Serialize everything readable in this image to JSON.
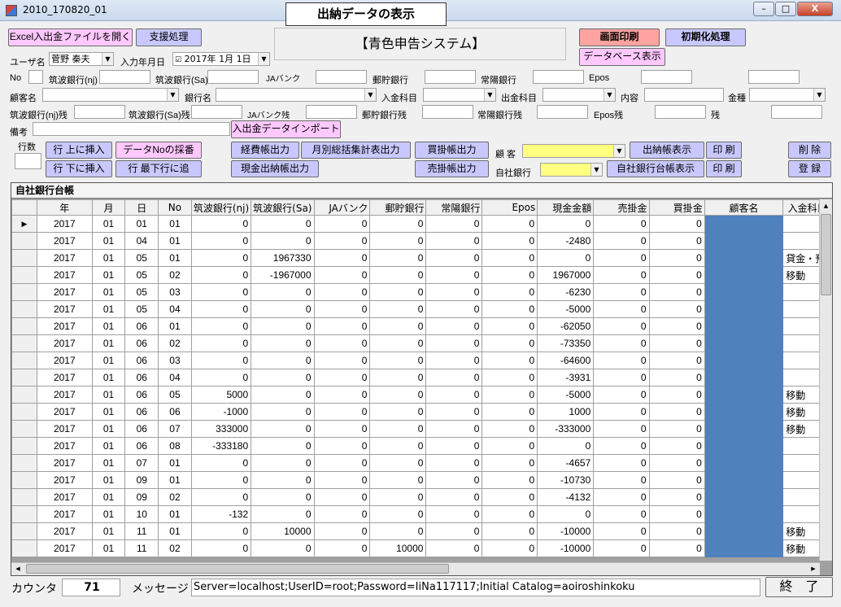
{
  "window": {
    "title": "2010_170820_01",
    "min": "–",
    "max": "□",
    "close": "X"
  },
  "header": {
    "form_title": "出納データの表示",
    "system_title": "【青色申告システム】"
  },
  "buttons": {
    "excel_open": "Excel入出金ファイルを開く",
    "support": "支援処理",
    "print_screen": "画面印刷",
    "init": "初期化処理",
    "db_view": "データベース表示",
    "import": "入出金データインポート",
    "insert_above": "行 上に挿入",
    "insert_below": "行 下に挿入",
    "renumber": "データNoの採番",
    "add_last": "行 最下行に追",
    "expense": "経費帳出力",
    "monthly": "月別総括集計表出力",
    "cash_book": "現金出納帳出力",
    "payable": "買掛帳出力",
    "receivable": "売掛帳出力",
    "cashbook_show": "出納帳表示",
    "print1": "印 刷",
    "print2": "印 刷",
    "bank_ledger": "自社銀行台帳表示",
    "delete": "削 除",
    "register": "登 録",
    "exit": "終　了"
  },
  "fields": {
    "user_label": "ユーザ名",
    "user_value": "菅野 秦夫",
    "date_label": "入力年月日",
    "date_value": "2017年  1月  1日",
    "no": "No",
    "tsukuba_nj": "筑波銀行(nj)",
    "tsukuba_sa": "筑波銀行(Sa)",
    "ja": "JAバンク",
    "yucho": "郵貯銀行",
    "joyo": "常陽銀行",
    "epos": "Epos",
    "customer": "顧客名",
    "bank": "銀行名",
    "in_item": "入金科目",
    "out_item": "出金科目",
    "content": "内容",
    "kind": "金種",
    "tsukuba_nj_bal": "筑波銀行(nj)残",
    "tsukuba_sa_bal": "筑波銀行(Sa)残",
    "ja_bal": "JAバンク残",
    "yucho_bal": "郵貯銀行残",
    "joyo_bal": "常陽銀行残",
    "epos_bal": "Epos残",
    "bal": "残",
    "memo": "備考",
    "rows": "行数",
    "kokyaku": "顧 客",
    "own_bank": "自社銀行"
  },
  "grid": {
    "caption": "自社銀行台帳",
    "columns": [
      "年",
      "月",
      "日",
      "No",
      "筑波銀行(nj)",
      "筑波銀行(Sa)",
      "JAバンク",
      "郵貯銀行",
      "常陽銀行",
      "Epos",
      "現金金額",
      "売掛金",
      "買掛金",
      "顧客名",
      "入金科目"
    ],
    "rows": [
      [
        "2017",
        "01",
        "01",
        "01",
        "0",
        "0",
        "0",
        "0",
        "0",
        "0",
        "0",
        "0",
        "0",
        "",
        ""
      ],
      [
        "2017",
        "01",
        "04",
        "01",
        "0",
        "0",
        "0",
        "0",
        "0",
        "0",
        "-2480",
        "0",
        "0",
        "",
        ""
      ],
      [
        "2017",
        "01",
        "05",
        "01",
        "0",
        "1967330",
        "0",
        "0",
        "0",
        "0",
        "0",
        "0",
        "0",
        "",
        "貸金・預"
      ],
      [
        "2017",
        "01",
        "05",
        "02",
        "0",
        "-1967000",
        "0",
        "0",
        "0",
        "0",
        "1967000",
        "0",
        "0",
        "",
        "移動"
      ],
      [
        "2017",
        "01",
        "05",
        "03",
        "0",
        "0",
        "0",
        "0",
        "0",
        "0",
        "-6230",
        "0",
        "0",
        "",
        ""
      ],
      [
        "2017",
        "01",
        "05",
        "04",
        "0",
        "0",
        "0",
        "0",
        "0",
        "0",
        "-5000",
        "0",
        "0",
        "",
        ""
      ],
      [
        "2017",
        "01",
        "06",
        "01",
        "0",
        "0",
        "0",
        "0",
        "0",
        "0",
        "-62050",
        "0",
        "0",
        "",
        ""
      ],
      [
        "2017",
        "01",
        "06",
        "02",
        "0",
        "0",
        "0",
        "0",
        "0",
        "0",
        "-73350",
        "0",
        "0",
        "",
        ""
      ],
      [
        "2017",
        "01",
        "06",
        "03",
        "0",
        "0",
        "0",
        "0",
        "0",
        "0",
        "-64600",
        "0",
        "0",
        "",
        ""
      ],
      [
        "2017",
        "01",
        "06",
        "04",
        "0",
        "0",
        "0",
        "0",
        "0",
        "0",
        "-3931",
        "0",
        "0",
        "",
        ""
      ],
      [
        "2017",
        "01",
        "06",
        "05",
        "5000",
        "0",
        "0",
        "0",
        "0",
        "0",
        "-5000",
        "0",
        "0",
        "",
        "移動"
      ],
      [
        "2017",
        "01",
        "06",
        "06",
        "-1000",
        "0",
        "0",
        "0",
        "0",
        "0",
        "1000",
        "0",
        "0",
        "",
        "移動"
      ],
      [
        "2017",
        "01",
        "06",
        "07",
        "333000",
        "0",
        "0",
        "0",
        "0",
        "0",
        "-333000",
        "0",
        "0",
        "",
        "移動"
      ],
      [
        "2017",
        "01",
        "06",
        "08",
        "-333180",
        "0",
        "0",
        "0",
        "0",
        "0",
        "0",
        "0",
        "0",
        "",
        ""
      ],
      [
        "2017",
        "01",
        "07",
        "01",
        "0",
        "0",
        "0",
        "0",
        "0",
        "0",
        "-4657",
        "0",
        "0",
        "",
        ""
      ],
      [
        "2017",
        "01",
        "09",
        "01",
        "0",
        "0",
        "0",
        "0",
        "0",
        "0",
        "-10730",
        "0",
        "0",
        "",
        ""
      ],
      [
        "2017",
        "01",
        "09",
        "02",
        "0",
        "0",
        "0",
        "0",
        "0",
        "0",
        "-4132",
        "0",
        "0",
        "",
        ""
      ],
      [
        "2017",
        "01",
        "10",
        "01",
        "-132",
        "0",
        "0",
        "0",
        "0",
        "0",
        "0",
        "0",
        "0",
        "",
        ""
      ],
      [
        "2017",
        "01",
        "11",
        "01",
        "0",
        "10000",
        "0",
        "0",
        "0",
        "0",
        "-10000",
        "0",
        "0",
        "",
        "移動"
      ],
      [
        "2017",
        "01",
        "11",
        "02",
        "0",
        "0",
        "0",
        "10000",
        "0",
        "0",
        "-10000",
        "0",
        "0",
        "",
        "移動"
      ]
    ]
  },
  "status": {
    "counter_label": "カウンタ",
    "counter_value": "71",
    "message_label": "メッセージ",
    "message_value": "Server=localhost;UserID=root;Password=IiNa117117;Initial Catalog=aoiroshinkoku"
  },
  "colors": {
    "pink": "#ffc8ff",
    "blue": "#c8c8ff",
    "salmon": "#ffa3a0",
    "yellow": "#ffff80",
    "customer_col": "#4f81bd"
  }
}
